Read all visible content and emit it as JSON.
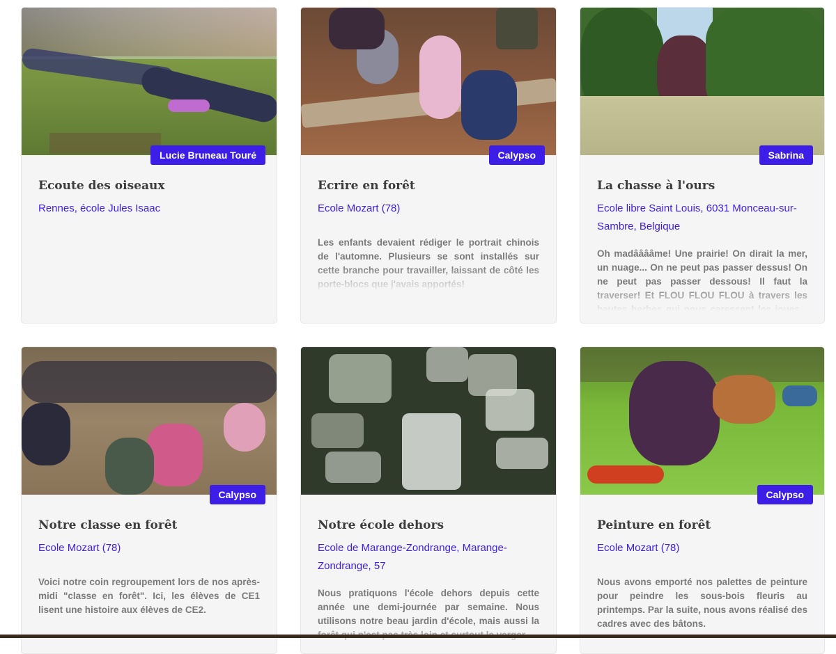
{
  "cards": [
    {
      "author": "Lucie Bruneau Touré",
      "title": "Ecoute des oiseaux",
      "location": "Rennes, école Jules Isaac",
      "description": ""
    },
    {
      "author": "Calypso",
      "title": "Ecrire en forêt",
      "location": "Ecole Mozart (78)",
      "description": "Les enfants devaient rédiger le portrait chinois de l'automne. Plusieurs se sont installés sur cette branche pour travailler, laissant de côté les porte-blocs que j'avais apportés!"
    },
    {
      "author": "Sabrina",
      "title": "La chasse à l'ours",
      "location": "Ecole libre Saint Louis, 6031 Monceau-sur-Sambre, Belgique",
      "description": "Oh madââââme! Une prairie! On dirait la mer, un nuage... On ne peut pas passer dessus! On ne peut pas passer dessous! Il faut la traverser! Et FLOU FLOU FLOU à travers les hautes herbes qui nous caressent les joues... La Chasse à l'Ours, ça"
    },
    {
      "author": "Calypso",
      "title": "Notre classe en forêt",
      "location": "Ecole Mozart (78)",
      "description": "Voici notre coin regroupement lors de nos après-midi \"classe en forêt\". Ici, les élèves de CE1 lisent une histoire aux élèves de CE2."
    },
    {
      "author": "",
      "title": "Notre école dehors",
      "location": "Ecole de Marange-Zondrange, Marange-Zondrange, 57",
      "description": "Nous pratiquons l'école dehors depuis cette année une demi-journée par semaine. Nous utilisons notre beau jardin d'école, mais aussi la forêt qui n'est pas très loin et surtout le verger"
    },
    {
      "author": "Calypso",
      "title": "Peinture en forêt",
      "location": "Ecole Mozart (78)",
      "description": "Nous avons emporté nos palettes de peinture pour peindre les sous-bois fleuris au printemps. Par la suite, nous avons réalisé des cadres avec des bâtons."
    }
  ]
}
